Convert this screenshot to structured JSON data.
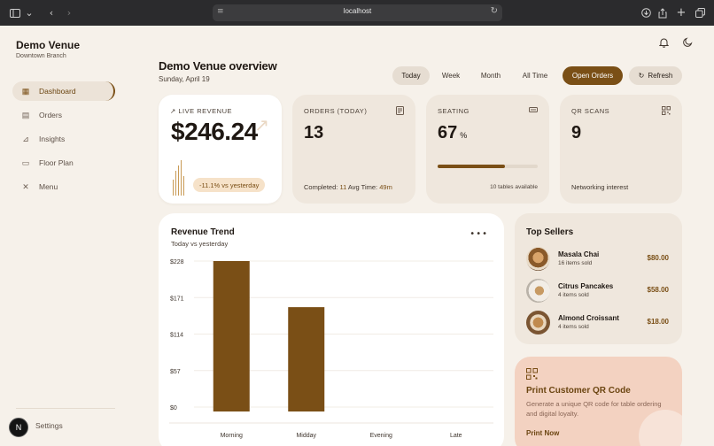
{
  "browser": {
    "url": "localhost",
    "icons": [
      "sidebar-icon",
      "chevron-down-icon",
      "back-icon",
      "forward-icon",
      "page-icon",
      "reload-icon",
      "download-icon",
      "share-icon",
      "plus-icon",
      "tabs-icon"
    ]
  },
  "sidebar": {
    "brand": "Demo Venue",
    "branch": "Downtown Branch",
    "items": [
      {
        "label": "Dashboard",
        "icon": "dashboard-icon",
        "active": true
      },
      {
        "label": "Orders",
        "icon": "orders-icon"
      },
      {
        "label": "Insights",
        "icon": "insights-icon"
      },
      {
        "label": "Floor Plan",
        "icon": "floor-plan-icon"
      },
      {
        "label": "Menu",
        "icon": "menu-icon"
      }
    ],
    "avatar_initial": "N",
    "settings_label": "Settings"
  },
  "header": {
    "title": "Demo Venue overview",
    "date": "Sunday, April 19",
    "filters": [
      "Today",
      "Week",
      "Month",
      "All Time"
    ],
    "active_filter": "Today",
    "open_orders_label": "Open Orders",
    "refresh_label": "Refresh"
  },
  "kpis": {
    "revenue": {
      "label": "LIVE REVENUE",
      "value": "$246.24",
      "delta": "-11.1% vs yesterday"
    },
    "orders": {
      "label": "ORDERS (TODAY)",
      "value": "13",
      "completed_label": "Completed:",
      "completed_value": "11",
      "avg_label": "Avg Time:",
      "avg_value": "49m"
    },
    "seating": {
      "label": "SEATING",
      "value": "67",
      "unit": "%",
      "occupancy": 0.67,
      "note": "10 tables available"
    },
    "qr": {
      "label": "QR SCANS",
      "value": "9",
      "note": "Networking interest"
    }
  },
  "trend": {
    "title": "Revenue Trend",
    "subtitle": "Today vs yesterday"
  },
  "chart_data": {
    "type": "bar",
    "categories": [
      "Morning",
      "Midday",
      "Evening",
      "Late"
    ],
    "values": [
      228,
      156,
      0,
      0
    ],
    "yticks": [
      "$228",
      "$171",
      "$114",
      "$57",
      "$0"
    ],
    "ylim": [
      0,
      228
    ],
    "color": "#7a4f16"
  },
  "sellers": {
    "title": "Top Sellers",
    "items": [
      {
        "name": "Masala Chai",
        "qty": "16 items sold",
        "price": "$80.00"
      },
      {
        "name": "Citrus Pancakes",
        "qty": "4 items sold",
        "price": "$58.00"
      },
      {
        "name": "Almond Croissant",
        "qty": "4 items sold",
        "price": "$18.00"
      }
    ]
  },
  "promo": {
    "title": "Print Customer QR Code",
    "desc": "Generate a unique QR code for table ordering and digital loyalty.",
    "cta": "Print Now"
  },
  "colors": {
    "accent": "#7a4f16",
    "bg": "#f6f1ea",
    "card": "#efe7dd",
    "promo": "#f3d2c1"
  }
}
